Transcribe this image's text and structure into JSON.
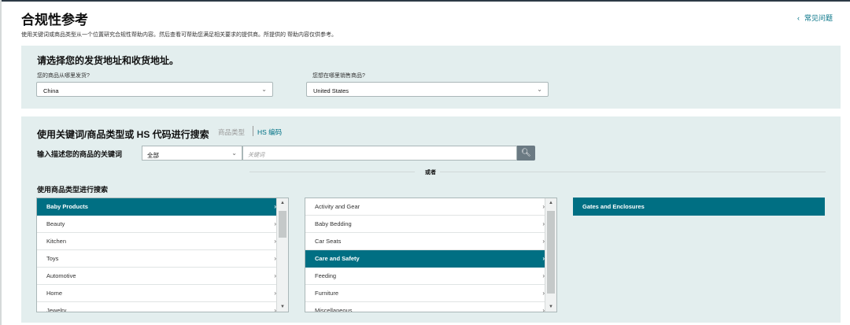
{
  "header": {
    "title": "合规性参考",
    "subtitle": "使用关键词或商品类型从一个位置研究合规性帮助内容。然后查看可帮助您满足相关要求的提供商。所提供的 帮助内容仅供参考。",
    "faq_label": "常见问题"
  },
  "address": {
    "title": "请选择您的发货地址和收货地址。",
    "ship_from_label": "您的商品从哪里发货?",
    "ship_from_value": "China",
    "sell_in_label": "您想在哪里销售商品?",
    "sell_in_value": "United States"
  },
  "search": {
    "title": "使用关键词/商品类型或 HS 代码进行搜索",
    "tab_category": "商品类型",
    "tab_hs": "HS 编码",
    "keyword_label": "输入描述您的商品的关键词",
    "scope_value": "全部",
    "keyword_placeholder": "关键词",
    "or_label": "或者",
    "category_label": "使用商品类型进行搜索"
  },
  "categories": {
    "level1": [
      "Baby Products",
      "Beauty",
      "Kitchen",
      "Toys",
      "Automotive",
      "Home",
      "Jewelry"
    ],
    "level2": [
      "Activity and Gear",
      "Baby Bedding",
      "Car Seats",
      "Care and Safety",
      "Feeding",
      "Furniture",
      "Miscellaneous"
    ],
    "level3": [
      "Gates and Enclosures"
    ]
  },
  "colors": {
    "accent": "#006f83",
    "panel": "#e3eeee",
    "link": "#007185"
  }
}
